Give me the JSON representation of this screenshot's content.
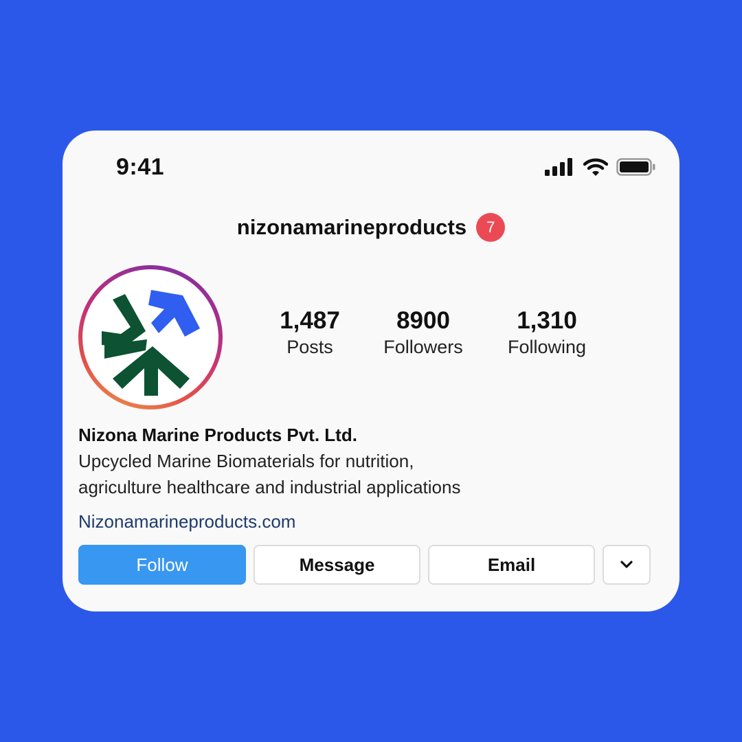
{
  "status_bar": {
    "time": "9:41",
    "icons": [
      "cellular-signal-icon",
      "wifi-icon",
      "battery-icon"
    ]
  },
  "profile": {
    "username": "nizonamarineproducts",
    "notification_count": "7",
    "avatar_logo": "nizona-logo"
  },
  "stats": [
    {
      "value": "1,487",
      "label": "Posts"
    },
    {
      "value": "8900",
      "label": "Followers"
    },
    {
      "value": "1,310",
      "label": "Following"
    }
  ],
  "bio": {
    "name": "Nizona Marine Products Pvt. Ltd.",
    "line1": "Upcycled Marine Biomaterials for nutrition,",
    "line2": "agriculture healthcare and industrial applications",
    "link": "Nizonamarineproducts.com"
  },
  "actions": {
    "follow": "Follow",
    "message": "Message",
    "email": "Email",
    "more_icon": "chevron-down-icon"
  },
  "colors": {
    "background": "#2c58e9",
    "card": "#f9f9f9",
    "follow_button": "#3897f0",
    "badge": "#eb4a55",
    "link": "#1e3b6e",
    "logo_green": "#0d5232",
    "logo_blue": "#2f5ef0"
  }
}
